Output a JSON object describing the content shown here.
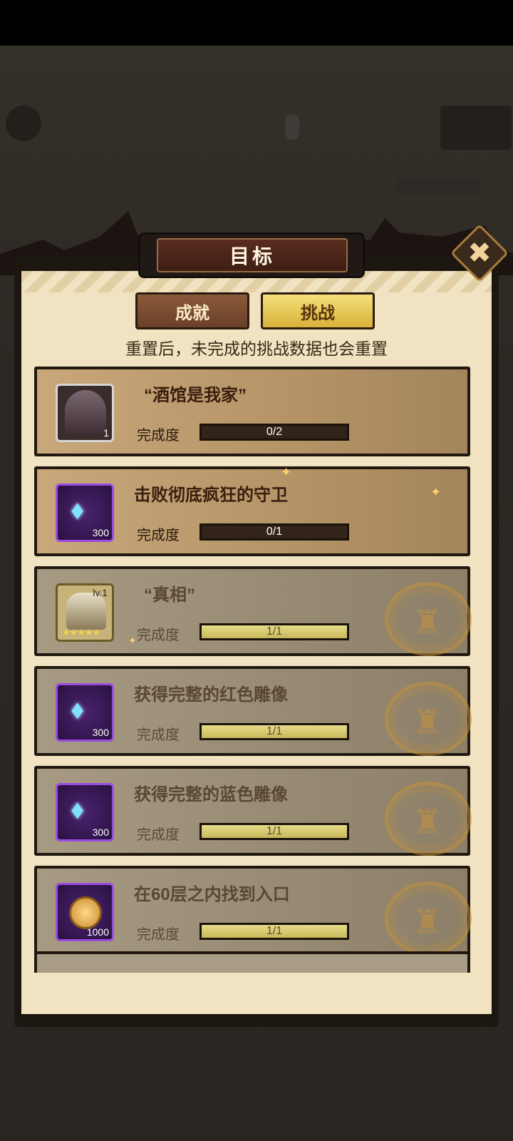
{
  "dialog": {
    "title": "目标",
    "close_symbol": "✖",
    "tabs": [
      {
        "label": "成就",
        "selected": false
      },
      {
        "label": "挑战",
        "selected": true
      }
    ],
    "notice": "重置后，未完成的挑战数据也会重置"
  },
  "challenges": [
    {
      "title": "“酒馆是我家”",
      "reward_icon": "character-portrait-icon",
      "reward_count": "1",
      "progress_label": "完成度",
      "progress_text": "0/2",
      "progress": 0.0,
      "completed": false
    },
    {
      "title": "击败彻底疯狂的守卫",
      "reward_icon": "diamond-icon",
      "reward_count": "300",
      "progress_label": "完成度",
      "progress_text": "0/1",
      "progress": 0.0,
      "completed": false
    },
    {
      "title": "“真相”",
      "reward_icon": "hero-card-icon",
      "reward_level": "lv.1",
      "reward_stars": "★★★★★",
      "progress_label": "完成度",
      "progress_text": "1/1",
      "progress": 1.0,
      "completed": true
    },
    {
      "title": "获得完整的红色雕像",
      "reward_icon": "diamond-icon",
      "reward_count": "300",
      "progress_label": "完成度",
      "progress_text": "1/1",
      "progress": 1.0,
      "completed": true
    },
    {
      "title": "获得完整的蓝色雕像",
      "reward_icon": "diamond-icon",
      "reward_count": "300",
      "progress_label": "完成度",
      "progress_text": "1/1",
      "progress": 1.0,
      "completed": true
    },
    {
      "title": "在60层之内找到入口",
      "reward_icon": "gold-coin-icon",
      "reward_count": "1000",
      "progress_label": "完成度",
      "progress_text": "1/1",
      "progress": 1.0,
      "completed": true
    }
  ],
  "colors": {
    "accent_gold": "#d8b23a",
    "parchment": "#f1e3c1",
    "reward_frame_purple": "#9a4be0"
  }
}
